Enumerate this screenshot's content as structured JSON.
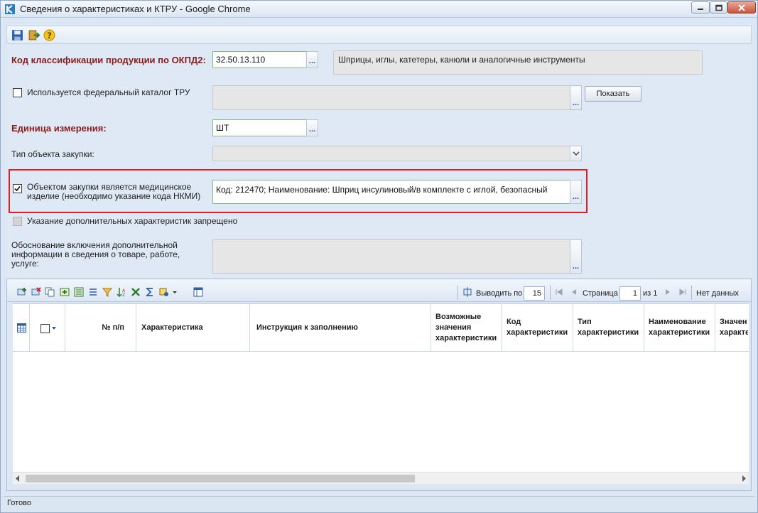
{
  "window": {
    "title": "Сведения о характеристиках и КТРУ - Google Chrome"
  },
  "toolbar": {
    "icons": [
      "save-icon",
      "exit-icon",
      "help-icon"
    ]
  },
  "form": {
    "okpd2": {
      "label": "Код классификации продукции по ОКПД2:",
      "value": "32.50.13.110",
      "description": "Шприцы, иглы, катетеры, канюли и аналогичные инструменты"
    },
    "federal_catalog": {
      "label": "Используется федеральный каталог ТРУ",
      "checked": false,
      "value": "",
      "show_button": "Показать"
    },
    "unit": {
      "label": "Единица измерения:",
      "value": "ШТ"
    },
    "object_type": {
      "label": "Тип объекта закупки:",
      "value": ""
    },
    "medical": {
      "label": "Объектом закупки является медицинское изделие (необходимо указание кода НКМИ)",
      "checked": true,
      "value": "Код: 212470; Наименование: Шприц инсулиновый/в комплекте с иглой, безопасный"
    },
    "extra_forbidden": {
      "label": "Указание дополнительных характеристик запрещено",
      "checked": false
    },
    "justification": {
      "label": "Обоснование включения дополнительной информации в сведения о товаре, работе, услуге:",
      "value": ""
    }
  },
  "grid": {
    "pager": {
      "show_label": "Выводить по",
      "page_size": "15",
      "page_label": "Страница",
      "page": "1",
      "of_label": "из 1",
      "no_data": "Нет данных"
    },
    "columns": [
      {
        "label": "№ п/п"
      },
      {
        "label": "Характеристика"
      },
      {
        "label": "Инструкция к заполнению"
      },
      {
        "label": "Возможные значения характеристики"
      },
      {
        "label": "Код характеристики"
      },
      {
        "label": "Тип характеристики"
      },
      {
        "label": "Наименование характеристики"
      },
      {
        "label": "Значен характе"
      }
    ]
  },
  "status": {
    "text": "Готово"
  }
}
